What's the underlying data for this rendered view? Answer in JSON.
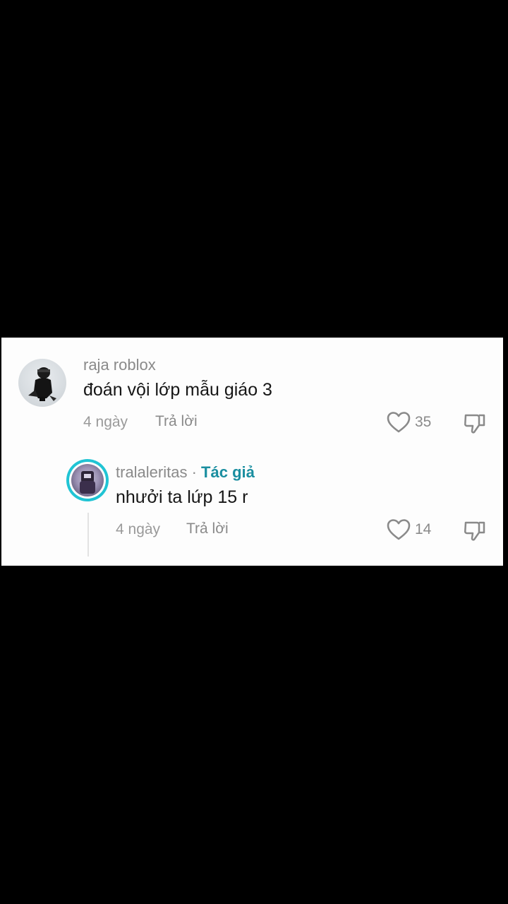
{
  "comments": [
    {
      "username": "raja roblox",
      "text": "đoán vội lớp mẫu giáo 3",
      "time": "4 ngày",
      "reply_label": "Trả lời",
      "likes": "35"
    }
  ],
  "replies": [
    {
      "username": "tralaleritas",
      "separator": " · ",
      "author_tag": "Tác giả",
      "text": "nhưởi ta lứp 15 r",
      "time": "4 ngày",
      "reply_label": "Trả lời",
      "likes": "14"
    }
  ],
  "icons": {
    "like": "heart-outline-icon",
    "dislike": "thumbs-down-icon"
  },
  "colors": {
    "author_accent": "#1a8ea0",
    "avatar_ring": "#20c4d4"
  }
}
